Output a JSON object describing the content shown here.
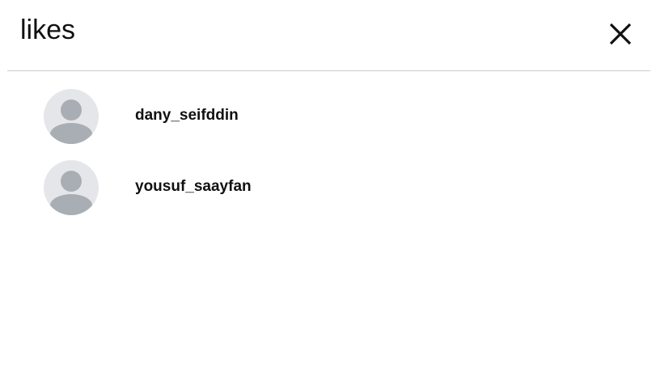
{
  "dialog": {
    "title": "likes",
    "close_icon": "close-icon"
  },
  "likes": [
    {
      "username": "dany_seifddin",
      "avatar_icon": "default-avatar-icon"
    },
    {
      "username": "yousuf_saayfan",
      "avatar_icon": "default-avatar-icon"
    }
  ],
  "colors": {
    "avatar_bg": "#e4e6e9",
    "avatar_fg": "#a9aeb4",
    "divider": "#cccccc",
    "text": "#111111"
  }
}
